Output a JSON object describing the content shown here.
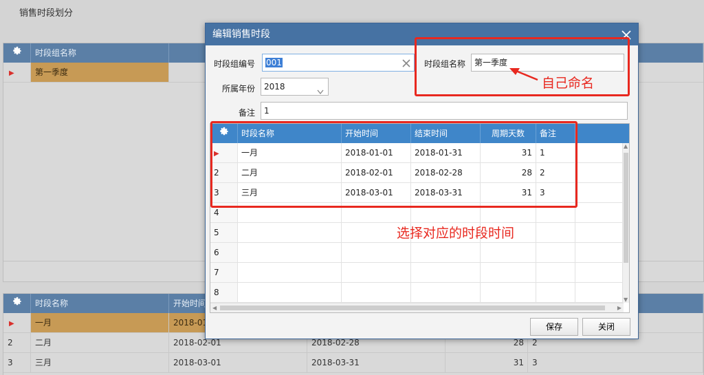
{
  "page": {
    "title": "销售时段划分"
  },
  "top_grid": {
    "header": {
      "name_col": "时段组名称"
    },
    "rows": [
      {
        "name": "第一季度"
      }
    ]
  },
  "bottom_grid": {
    "header": {
      "name_col": "时段名称",
      "start_col": "开始时间"
    },
    "rows": [
      {
        "num": "",
        "name": "一月",
        "start": "2018-01-",
        "end": "",
        "days": "",
        "note": ""
      },
      {
        "num": "2",
        "name": "二月",
        "start": "2018-02-01",
        "end": "2018-02-28",
        "days": "28",
        "note": "2"
      },
      {
        "num": "3",
        "name": "三月",
        "start": "2018-03-01",
        "end": "2018-03-31",
        "days": "31",
        "note": "3"
      }
    ]
  },
  "dialog": {
    "title": "编辑销售时段",
    "group_no_label": "时段组编号",
    "group_no_value": "001",
    "group_name_label": "时段组名称",
    "group_name_value": "第一季度",
    "year_label": "所属年份",
    "year_value": "2018",
    "note_label": "备注",
    "note_value": "1",
    "grid": {
      "headers": [
        "时段名称",
        "开始时间",
        "结束时间",
        "周期天数",
        "备注"
      ],
      "rows": [
        {
          "num": "",
          "name": "一月",
          "start": "2018-01-01",
          "end": "2018-01-31",
          "days": "31",
          "note": "1"
        },
        {
          "num": "2",
          "name": "二月",
          "start": "2018-02-01",
          "end": "2018-02-28",
          "days": "28",
          "note": "2"
        },
        {
          "num": "3",
          "name": "三月",
          "start": "2018-03-01",
          "end": "2018-03-31",
          "days": "31",
          "note": "3"
        },
        {
          "num": "4",
          "name": "",
          "start": "",
          "end": "",
          "days": "",
          "note": ""
        },
        {
          "num": "5",
          "name": "",
          "start": "",
          "end": "",
          "days": "",
          "note": ""
        },
        {
          "num": "6",
          "name": "",
          "start": "",
          "end": "",
          "days": "",
          "note": ""
        },
        {
          "num": "7",
          "name": "",
          "start": "",
          "end": "",
          "days": "",
          "note": ""
        },
        {
          "num": "8",
          "name": "",
          "start": "",
          "end": "",
          "days": "",
          "note": ""
        }
      ]
    },
    "save_label": "保存",
    "close_label": "关闭"
  },
  "annotations": {
    "name_hint": "自己命名",
    "period_hint": "选择对应的时段时间"
  },
  "colors": {
    "dialog_header": "#4672a3",
    "grid_header": "#3f86c9",
    "selected_row": "#c79a55",
    "annotation": "#e8281f"
  }
}
